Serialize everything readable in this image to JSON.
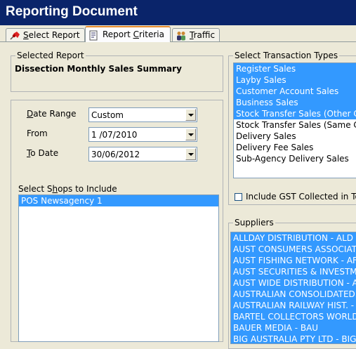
{
  "window": {
    "title": "Reporting Document"
  },
  "tabs": [
    {
      "label": "Select Report",
      "mnemonic": "S",
      "rest": "elect Report",
      "icon": "pin-icon",
      "active": false
    },
    {
      "label": "Report Criteria",
      "mnemonic": "C",
      "pre": "Report ",
      "rest": "riteria",
      "icon": "report-icon",
      "active": true
    },
    {
      "label": "Traffic",
      "mnemonic": "T",
      "rest": "raffic",
      "icon": "people-icon",
      "active": false
    }
  ],
  "selected_report": {
    "legend": "Selected Report",
    "name": "Dissection Monthly Sales Summary"
  },
  "date_criteria": {
    "date_range_label": "Date Range",
    "date_range_value": "Custom",
    "from_label": "From",
    "from_value": "1 /07/2010",
    "to_date_label": "To Date",
    "to_date_value": "30/06/2012"
  },
  "shops": {
    "label": "Select Shops to Include",
    "items": [
      {
        "text": "POS Newsagency 1",
        "selected": true
      }
    ]
  },
  "transaction_types": {
    "legend": "Select Transaction Types",
    "items": [
      {
        "text": "Register Sales",
        "selected": true
      },
      {
        "text": "Layby Sales",
        "selected": true
      },
      {
        "text": "Customer Account Sales",
        "selected": true
      },
      {
        "text": "Business Sales",
        "selected": true
      },
      {
        "text": "Stock Transfer Sales (Other C",
        "selected": true
      },
      {
        "text": "Stock Transfer Sales (Same C",
        "selected": false
      },
      {
        "text": "Delivery Sales",
        "selected": false
      },
      {
        "text": "Delivery Fee Sales",
        "selected": false
      },
      {
        "text": "Sub-Agency Delivery Sales",
        "selected": false
      }
    ],
    "include_gst_label": "Include GST Collected in To",
    "include_gst_checked": false
  },
  "suppliers": {
    "legend": "Suppliers",
    "items": [
      "ALLDAY DISTRIBUTION - ALD",
      "AUST CONSUMERS ASSOCIAT",
      "AUST FISHING NETWORK - AF",
      "AUST SECURITIES & INVESTM",
      "AUST WIDE DISTRIBUTION - A",
      "AUSTRALIAN CONSOLIDATED P",
      "AUSTRALIAN RAILWAY HIST. -",
      "BARTEL COLLECTORS WORLD",
      "BAUER MEDIA - BAU",
      "BIG AUSTRALIA PTY LTD - BIG"
    ]
  },
  "colors": {
    "titlebar": "#0a246a",
    "selection": "#3399ff",
    "face": "#ece9d8",
    "tab_highlight": "#e68b2c"
  }
}
